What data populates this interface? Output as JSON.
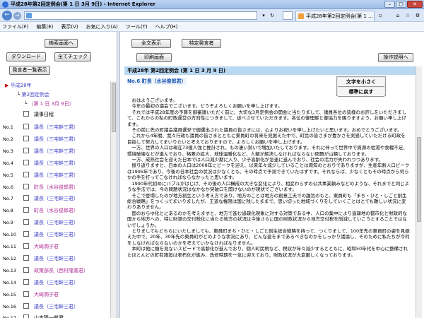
{
  "window": {
    "title": "平成28年第2回定例会(第 1 日 3月 9日) - Internet Explorer"
  },
  "tab": {
    "label": "平成28年第2回定例会(第 1 ..."
  },
  "menu": [
    "ファイル(F)",
    "編集(E)",
    "表示(V)",
    "お気に入り(A)",
    "ツール(T)",
    "ヘルプ(H)"
  ],
  "left": {
    "search_screen": "検索画面へ",
    "download": "ダウンロード",
    "check_all": "全てチェック",
    "show_member_list": "発言者一覧表示",
    "tree_year": "平成28年",
    "tree_session": "第2回定例会",
    "tree_day": "（第 1 日 3月 9日）",
    "agenda": "議事日程",
    "rows": [
      {
        "no": "No.1",
        "name": "議長（三宅幹三君）",
        "color": "#3a3fc4"
      },
      {
        "no": "No.2",
        "name": "議長（三宅幹三君）",
        "color": "#3a3fc4"
      },
      {
        "no": "No.3",
        "name": "議長（三宅幹三君）",
        "color": "#3a3fc4"
      },
      {
        "no": "No.4",
        "name": "議長（三宅幹三君）",
        "color": "#3a3fc4"
      },
      {
        "no": "No.5",
        "name": "議長（三宅幹三君）",
        "color": "#3a3fc4"
      },
      {
        "no": "No.6",
        "name": "町長（水谷俊郎君）",
        "color": "#b0309a"
      },
      {
        "no": "No.7",
        "name": "議長（三宅幹三君）",
        "color": "#3a3fc4"
      },
      {
        "no": "No.8",
        "name": "町長（水谷俊郎君）",
        "color": "#b0309a"
      },
      {
        "no": "No.9",
        "name": "議長（三宅幹三君）",
        "color": "#3a3fc4"
      },
      {
        "no": "No.10",
        "name": "議長（三宅幹三君）",
        "color": "#3a3fc4"
      },
      {
        "no": "No.11",
        "name": "大崎潤子君",
        "color": "#b0309a"
      },
      {
        "no": "No.12",
        "name": "議長（三宅幹三君）",
        "color": "#3a3fc4"
      },
      {
        "no": "No.13",
        "name": "政策部長（西村隆義君）",
        "color": "#b0309a"
      },
      {
        "no": "No.14",
        "name": "議長（三宅幹三君）",
        "color": "#3a3fc4"
      },
      {
        "no": "No.15",
        "name": "大崎潤子君",
        "color": "#b0309a"
      },
      {
        "no": "No.16",
        "name": "議長（三宅幹三君）",
        "color": "#3a3fc4"
      },
      {
        "no": "No.17",
        "name": "山本陽一郎君",
        "color": "#000000"
      }
    ]
  },
  "right": {
    "show_all": "全文表示",
    "specify_speaker": "特定発言者",
    "print_screen": "印刷画面",
    "help": "操作説明へ",
    "header": "平成28年 第2回定例会 (第 1 日 3 月 9 日)",
    "speaker": "No.6 町長（水谷俊郎君）",
    "font_smaller": "文字を小さく",
    "font_reset": "標準に戻す"
  },
  "content": [
    "　おはようございます。",
    "　今年の最初の議会でございます。どうぞよろしくお願いを申し上げます。",
    "　それでは平成28年度の予算を御審議いただく前に、大切な3月定例会の開会に当たりまして、議員各位の皆様のお許しをいただきまして、これからの私の町政運営の方向性につきまして、述べさせていただきます。各位の御理解と御協力を賜りますよう、お願い申し上げます。",
    "　その前に先の町議会議員選挙で御選出された議員の皆さまには、心よりお祝いを申し上げたいと思います。おめでとうございます。",
    "　これから4年間、我々行政も議員の皆さまとともに東員町の将来を見据えた中で、町民の皆さまが豊かさを実感していただける町政を目指して努力してまいりたいと考えておりますので、よろしくお願いを申し上げます。",
    "　一方、世界の人口は現在73億人強と推計され、もの凄い勢いで増加いたしております。それに伴って世界中で資源の枯渇や食糧不足、環境破壊などが進んでおり、格差の拡大、地球温暖化など、人類が解決しなければならない問題が山積しております。",
    "　一方、成熟社会を迎えた日本では人口減少期に入り、少子高齢化が急速に進んでおり、社会の活力が失われつつあります。",
    "　振り返りますと、日本の人口は2008年にピークを迎え、以来年々減少していることは周知のとおりでありますが、生産年齢人口ピークは1995年であり、今後の日本社会の状況は少なくとも、その時点で予測できていたはずです。それならば、少なくともその時点から何らかの手を打ってこなければならなかったと思います。",
    "　1990年代初めにバブルがはじけ、その後の人口構成の大きな変化により、相変わらずの公共事業頼みなどのような、それまでと同じような手法では、今の問題状況はなかなか突破口を開けないのが現状でございます。",
    "　そこで登場したのが地方創生という考え方であり、地方のことは地方の創意工夫での趣旨のもと、東員町も「まち・ひと・しごと創生総合戦略」をつくってまいりましたが、王道な権限は国に残したままで、思い切った地域づくりをしていくことはとても難しい状況に変わりありません。",
    "　国のおらゆ化とにあるのかを考えますと、地方で進む過疎化現象に対する対策である中、人口の集中により過疎地の都市化と財政的な国から地方への、特に財源の交付税化に当たる地方の状況は今後さらに国の財政状況から地方交付税を削減していこうとすることではないでしょうか。",
    "　とりましてもどちらにいたしましても、東員町まち・ひと・しごと創生総合戦略を持って、つくりまして、100年先の東員町の姿を見据えた中で、20年、30年先の東員町がどのような状況にあり、どんな姿をまであるべきなのかをしっかり議論し、そのために私たちが今何をしなければならないのかを考えていかなければなりません。",
    "　本町は他に類を見ないスピードで高齢化が進んでおり、個人町民税など、税収が年々減少するとともに、昭和50年代を中心に整備されたほとんどの町有施設は老朽化が進み、改修時期を一気に迎えており、財政状況が大変厳しくなっております。"
  ]
}
